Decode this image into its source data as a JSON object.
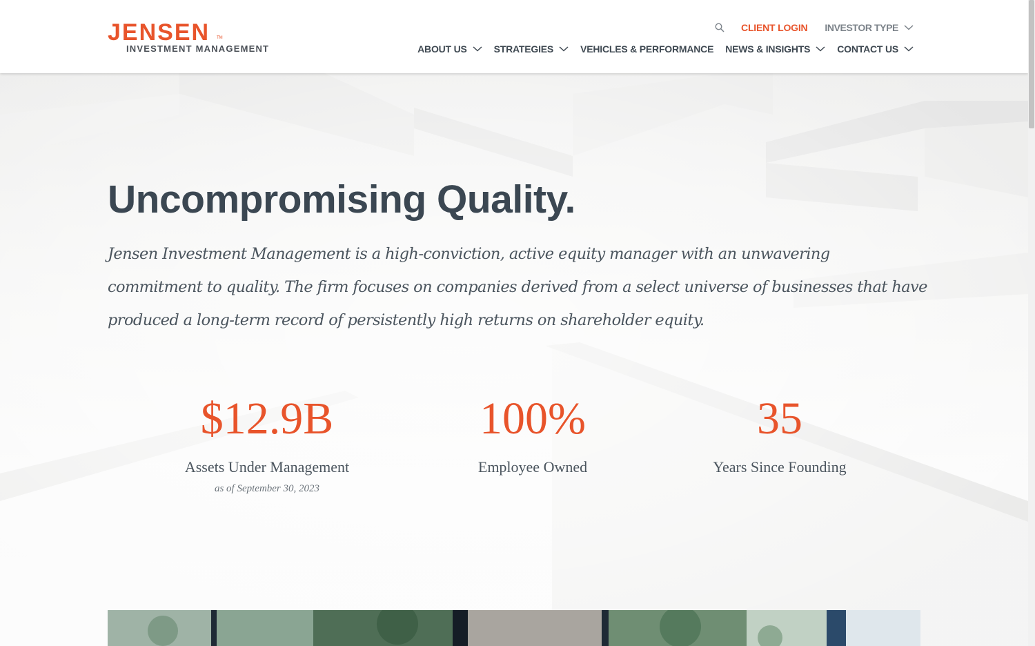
{
  "brand": {
    "name_top": "JENSEN",
    "trademark": "TM",
    "name_bottom": "INVESTMENT MANAGEMENT",
    "accent_color": "#e8542b",
    "text_color": "#3b4752"
  },
  "utility_nav": {
    "search_icon": "search-icon",
    "client_login": "CLIENT LOGIN",
    "investor_type": "INVESTOR TYPE"
  },
  "main_nav": [
    {
      "label": "ABOUT US",
      "has_dropdown": true
    },
    {
      "label": "STRATEGIES",
      "has_dropdown": true
    },
    {
      "label": "VEHICLES & PERFORMANCE",
      "has_dropdown": false
    },
    {
      "label": "NEWS & INSIGHTS",
      "has_dropdown": true
    },
    {
      "label": "CONTACT US",
      "has_dropdown": true
    }
  ],
  "hero": {
    "title": "Uncompromising Quality.",
    "intro": "Jensen Investment Management is a high-conviction, active equity manager with an unwavering commitment to quality. The firm focuses on companies derived from a select universe of businesses that have produced a long-term record of persistently high returns on shareholder equity."
  },
  "stats": [
    {
      "value": "$12.9B",
      "label": "Assets Under Management",
      "note": "as of September 30, 2023"
    },
    {
      "value": "100%",
      "label": "Employee Owned",
      "note": ""
    },
    {
      "value": "35",
      "label": "Years Since Founding",
      "note": ""
    }
  ]
}
